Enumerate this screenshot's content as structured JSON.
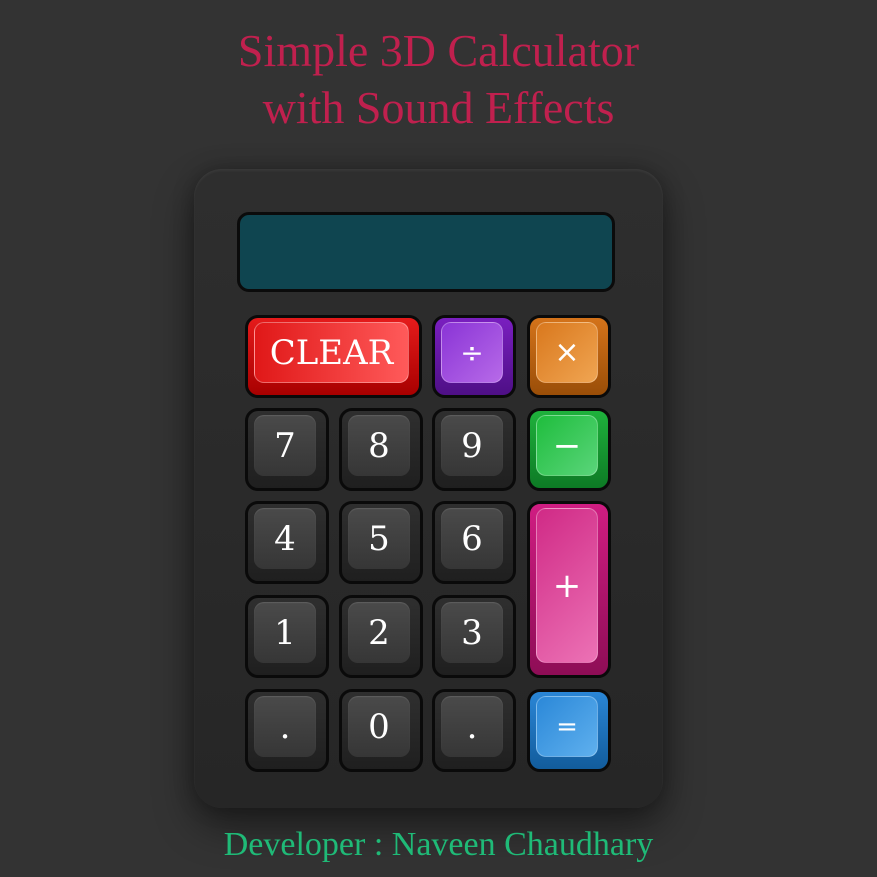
{
  "title": {
    "line1": "Simple 3D Calculator",
    "line2": "with Sound Effects"
  },
  "display": {
    "value": ""
  },
  "keys": {
    "clear": "CLEAR",
    "divide": "÷",
    "multiply": "×",
    "subtract": "−",
    "add": "+",
    "equals": "=",
    "seven": "7",
    "eight": "8",
    "nine": "9",
    "four": "4",
    "five": "5",
    "six": "6",
    "one": "1",
    "two": "2",
    "three": "3",
    "dot_left": ".",
    "zero": "0",
    "dot_right": "."
  },
  "footer": {
    "developer": "Developer : Naveen Chaudhary"
  },
  "colors": {
    "background": "#333333",
    "title": "#c0204e",
    "footer": "#1fba77",
    "display": "#0f4550",
    "clear": "#e01818",
    "divide": "#8a34d6",
    "multiply": "#d9781d",
    "subtract": "#1fbd3d",
    "add": "#d02a86",
    "equals": "#2b88d8"
  }
}
